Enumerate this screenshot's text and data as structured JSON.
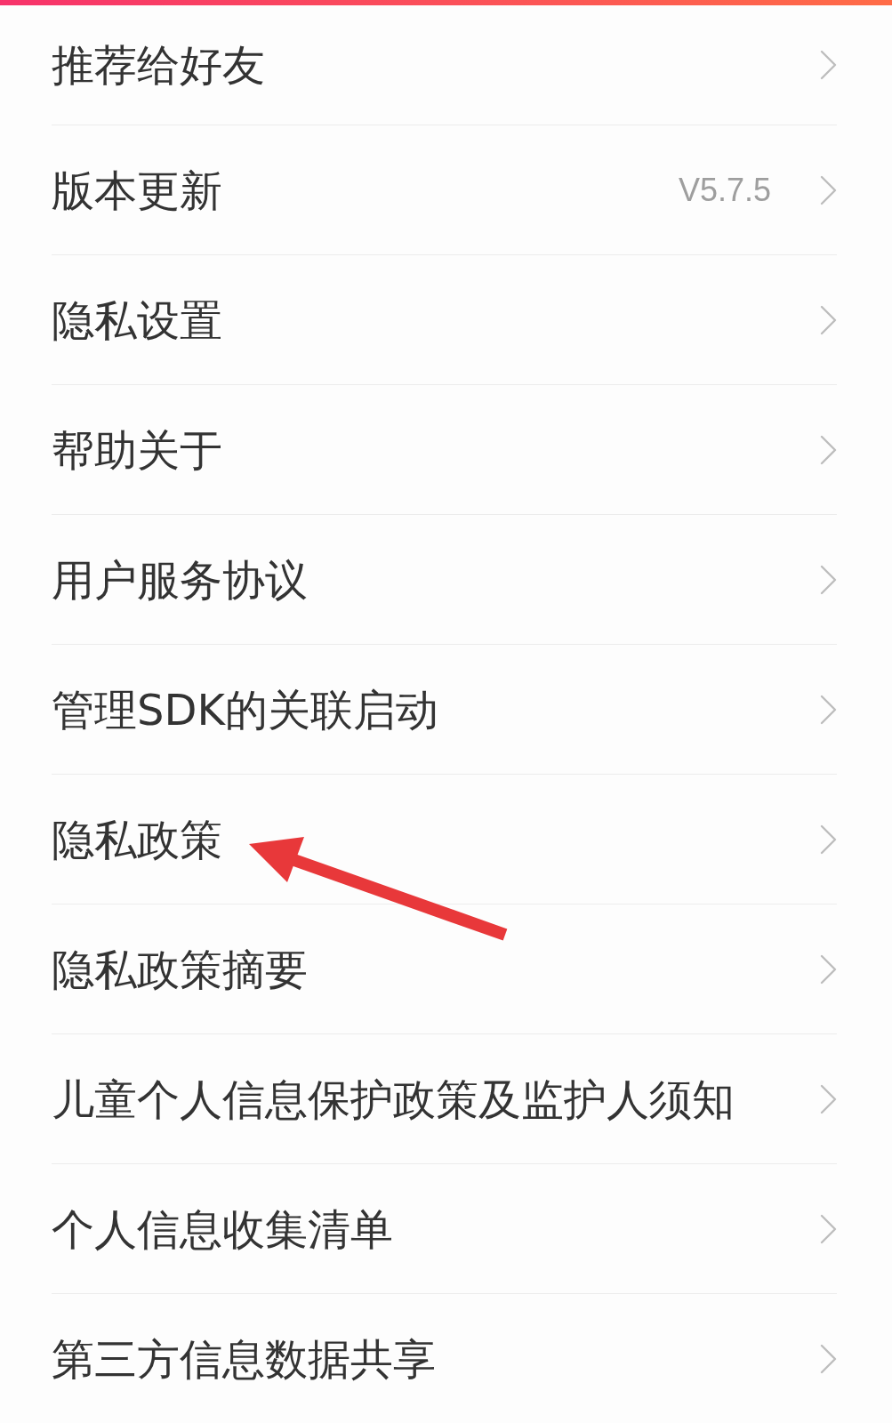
{
  "settings_list": {
    "items": [
      {
        "label": "推荐给好友",
        "pointed_at": false
      },
      {
        "label": "版本更新",
        "value": "V5.7.5",
        "pointed_at": false
      },
      {
        "label": "隐私设置",
        "pointed_at": false
      },
      {
        "label": "帮助关于",
        "pointed_at": false
      },
      {
        "label": "用户服务协议",
        "pointed_at": false
      },
      {
        "label": "管理SDK的关联启动",
        "pointed_at": false
      },
      {
        "label": "隐私政策",
        "pointed_at": true
      },
      {
        "label": "隐私政策摘要",
        "pointed_at": false
      },
      {
        "label": "儿童个人信息保护政策及监护人须知",
        "pointed_at": false
      },
      {
        "label": "个人信息收集清单",
        "pointed_at": false
      },
      {
        "label": "第三方信息数据共享",
        "pointed_at": false
      }
    ]
  }
}
